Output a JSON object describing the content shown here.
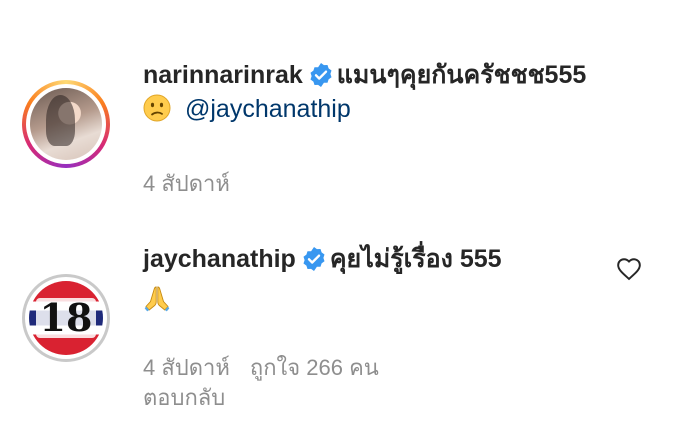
{
  "comments": [
    {
      "username": "narinnarinrak",
      "verified": true,
      "text": "แมนๆคุยกันครัชชช555",
      "emoji": "confused-face",
      "mention": "@jaychanathip",
      "time": "4 สัปดาห์"
    },
    {
      "username": "jaychanathip",
      "verified": true,
      "text": "คุยไม่รู้เรื่อง 555",
      "emoji": "folded-hands",
      "jersey_number": "18",
      "time": "4 สัปดาห์",
      "likes": "ถูกใจ 266 คน",
      "reply": "ตอบกลับ",
      "icon": "heart-icon"
    }
  ],
  "colors": {
    "verified": "#3897f0",
    "mention": "#00376b",
    "meta": "#8e8e8e"
  }
}
